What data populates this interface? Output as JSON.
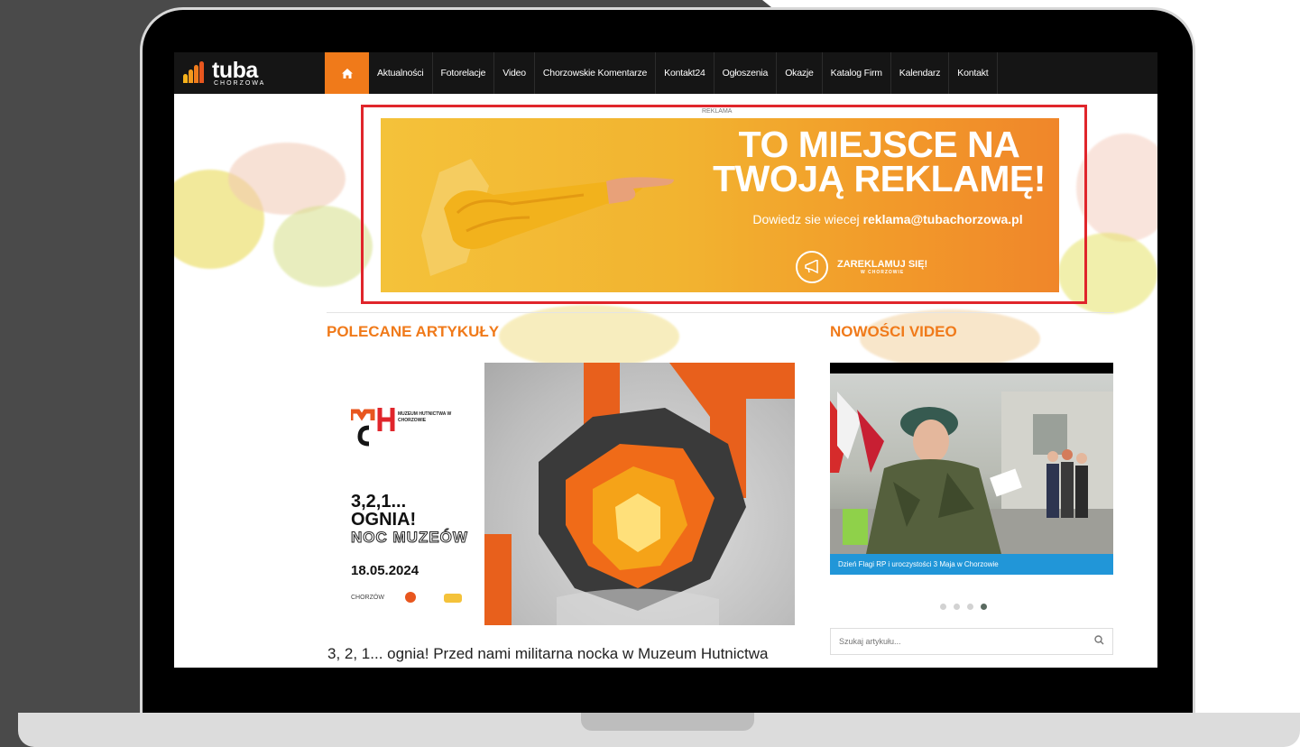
{
  "nav": {
    "logo_main": "tuba",
    "logo_sub": "CHORZOWA",
    "items": [
      "Aktualności",
      "Fotorelacje",
      "Video",
      "Chorzowskie Komentarze",
      "Kontakt24",
      "Ogłoszenia",
      "Okazje",
      "Katalog Firm",
      "Kalendarz",
      "Kontakt"
    ]
  },
  "ad": {
    "label": "REKLAMA",
    "headline_line1": "TO MIEJSCE NA",
    "headline_line2": "TWOJĄ REKLAMĘ!",
    "sub_prefix": "Dowiedz sie wiecej",
    "sub_email": "reklama@tubachorzowa.pl",
    "cta": "ZAREKLAMUJ SIĘ!",
    "cta_sub": "W CHORZOWIE"
  },
  "sections": {
    "recommended": "POLECANE ARTYKUŁY",
    "video": "NOWOŚCI VIDEO"
  },
  "feature": {
    "poster_line1": "3,2,1...",
    "poster_line2": "OGNIA!",
    "poster_line3": "NOC MUZEÓW",
    "poster_date": "18.05.2024",
    "poster_museum": "MUZEUM HUTNICTWA W CHORZOWIE",
    "poster_city": "CHORZÓW",
    "title": "3, 2, 1... ognia! Przed nami militarna nocka w Muzeum Hutnictwa"
  },
  "video": {
    "caption": "Dzień Flagi RP i uroczystości 3 Maja w Chorzowie",
    "slides": 4,
    "active_slide": 4
  },
  "search": {
    "placeholder": "Szukaj artykułu..."
  },
  "colors": {
    "accent": "#f07a1a",
    "nav_bg": "#151515",
    "ad_frame": "#e0252b",
    "caption_bg": "#2196d8"
  }
}
